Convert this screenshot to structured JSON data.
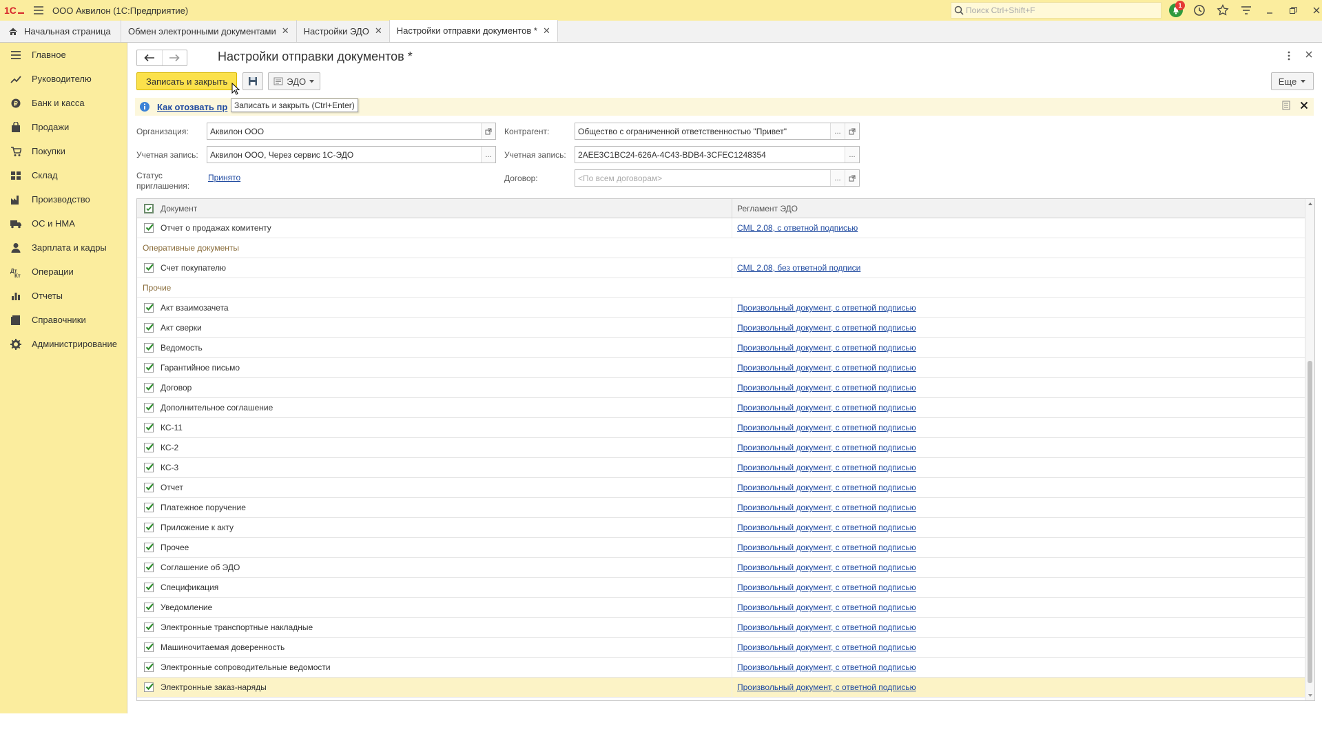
{
  "app": {
    "title": "ООО Аквилон  (1С:Предприятие)",
    "search_placeholder": "Поиск Ctrl+Shift+F",
    "notification_count": "1"
  },
  "tabs": [
    {
      "label": "Начальная страница"
    },
    {
      "label": "Обмен электронными документами"
    },
    {
      "label": "Настройки ЭДО"
    },
    {
      "label": "Настройки отправки документов *"
    }
  ],
  "sidebar": {
    "items": [
      {
        "label": "Главное",
        "icon": "menu-lines-icon"
      },
      {
        "label": "Руководителю",
        "icon": "trend-icon"
      },
      {
        "label": "Банк и касса",
        "icon": "coin-icon"
      },
      {
        "label": "Продажи",
        "icon": "bag-icon"
      },
      {
        "label": "Покупки",
        "icon": "cart-icon"
      },
      {
        "label": "Склад",
        "icon": "warehouse-icon"
      },
      {
        "label": "Производство",
        "icon": "factory-icon"
      },
      {
        "label": "ОС и НМА",
        "icon": "truck-icon"
      },
      {
        "label": "Зарплата и кадры",
        "icon": "person-icon"
      },
      {
        "label": "Операции",
        "icon": "operations-icon"
      },
      {
        "label": "Отчеты",
        "icon": "chart-icon"
      },
      {
        "label": "Справочники",
        "icon": "book-icon"
      },
      {
        "label": "Администрирование",
        "icon": "gear-icon"
      }
    ]
  },
  "form": {
    "title": "Настройки отправки документов *",
    "save_close_label": "Записать и закрыть",
    "edo_label": "ЭДО",
    "more_label": "Еще",
    "tooltip": "Записать и закрыть (Ctrl+Enter)",
    "info_link": "Как отозвать пр",
    "org_label": "Организация:",
    "org_value": "Аквилон ООО",
    "account_label": "Учетная запись:",
    "account_value": "Аквилон ООО, Через сервис 1С-ЭДО",
    "status_label_line1": "Статус",
    "status_label_line2": "приглашения:",
    "status_value": "Принято",
    "counterparty_label": "Контрагент:",
    "counterparty_value": "Общество с ограниченной ответственностью \"Привет\"",
    "cp_account_label": "Учетная запись:",
    "cp_account_value": "2AEE3C1BC24-626A-4C43-BDB4-3CFEC1248354",
    "contract_label": "Договор:",
    "contract_placeholder": "<По всем договорам>"
  },
  "table": {
    "columns": {
      "document": "Документ",
      "regulation": "Регламент ЭДО"
    },
    "rows": [
      {
        "type": "item",
        "document": "Отчет о продажах комитенту",
        "regulation": "CML 2.08, с ответной подписью"
      },
      {
        "type": "group",
        "label": "Оперативные документы"
      },
      {
        "type": "item",
        "document": "Счет покупателю",
        "regulation": "CML 2.08, без ответной подписи"
      },
      {
        "type": "group",
        "label": "Прочие"
      },
      {
        "type": "item",
        "document": "Акт взаимозачета",
        "regulation": "Произвольный документ, с ответной подписью"
      },
      {
        "type": "item",
        "document": "Акт сверки",
        "regulation": "Произвольный документ, с ответной подписью"
      },
      {
        "type": "item",
        "document": "Ведомость",
        "regulation": "Произвольный документ, с ответной подписью"
      },
      {
        "type": "item",
        "document": "Гарантийное письмо",
        "regulation": "Произвольный документ, с ответной подписью"
      },
      {
        "type": "item",
        "document": "Договор",
        "regulation": "Произвольный документ, с ответной подписью"
      },
      {
        "type": "item",
        "document": "Дополнительное соглашение",
        "regulation": "Произвольный документ, с ответной подписью"
      },
      {
        "type": "item",
        "document": "КС-11",
        "regulation": "Произвольный документ, с ответной подписью"
      },
      {
        "type": "item",
        "document": "КС-2",
        "regulation": "Произвольный документ, с ответной подписью"
      },
      {
        "type": "item",
        "document": "КС-3",
        "regulation": "Произвольный документ, с ответной подписью"
      },
      {
        "type": "item",
        "document": "Отчет",
        "regulation": "Произвольный документ, с ответной подписью"
      },
      {
        "type": "item",
        "document": "Платежное поручение",
        "regulation": "Произвольный документ, с ответной подписью"
      },
      {
        "type": "item",
        "document": "Приложение к акту",
        "regulation": "Произвольный документ, с ответной подписью"
      },
      {
        "type": "item",
        "document": "Прочее",
        "regulation": "Произвольный документ, с ответной подписью"
      },
      {
        "type": "item",
        "document": "Соглашение об ЭДО",
        "regulation": "Произвольный документ, с ответной подписью"
      },
      {
        "type": "item",
        "document": "Спецификация",
        "regulation": "Произвольный документ, с ответной подписью"
      },
      {
        "type": "item",
        "document": "Уведомление",
        "regulation": "Произвольный документ, с ответной подписью"
      },
      {
        "type": "item",
        "document": "Электронные транспортные накладные",
        "regulation": "Произвольный документ, с ответной подписью"
      },
      {
        "type": "item",
        "document": "Машиночитаемая доверенность",
        "regulation": "Произвольный документ, с ответной подписью"
      },
      {
        "type": "item",
        "document": "Электронные сопроводительные ведомости",
        "regulation": "Произвольный документ, с ответной подписью"
      },
      {
        "type": "item",
        "document": "Электронные заказ-наряды",
        "regulation": "Произвольный документ, с ответной подписью",
        "selected": true
      }
    ]
  },
  "colors": {
    "accent_yellow": "#fbed9e",
    "button_yellow": "#fbe14b",
    "link_blue": "#1f4aa0",
    "check_green": "#2e8b2e",
    "group_text": "#8a6d3b"
  }
}
